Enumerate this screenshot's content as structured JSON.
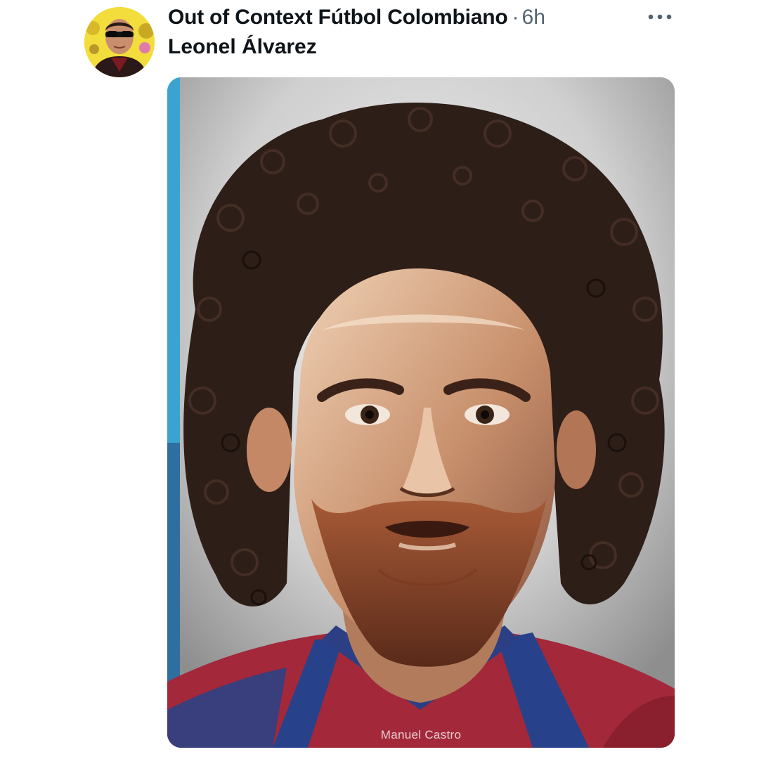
{
  "post": {
    "author": {
      "display_name": "Out of Context Fútbol Colombiano",
      "separator": "·",
      "timestamp": "6h"
    },
    "more_icon": "more-horizontal-icon",
    "text": "Leonel Álvarez",
    "media": {
      "signature": "Manuel Castro"
    }
  },
  "colors": {
    "name_text": "#0f1419",
    "muted_text": "#536471",
    "background": "#ffffff"
  }
}
